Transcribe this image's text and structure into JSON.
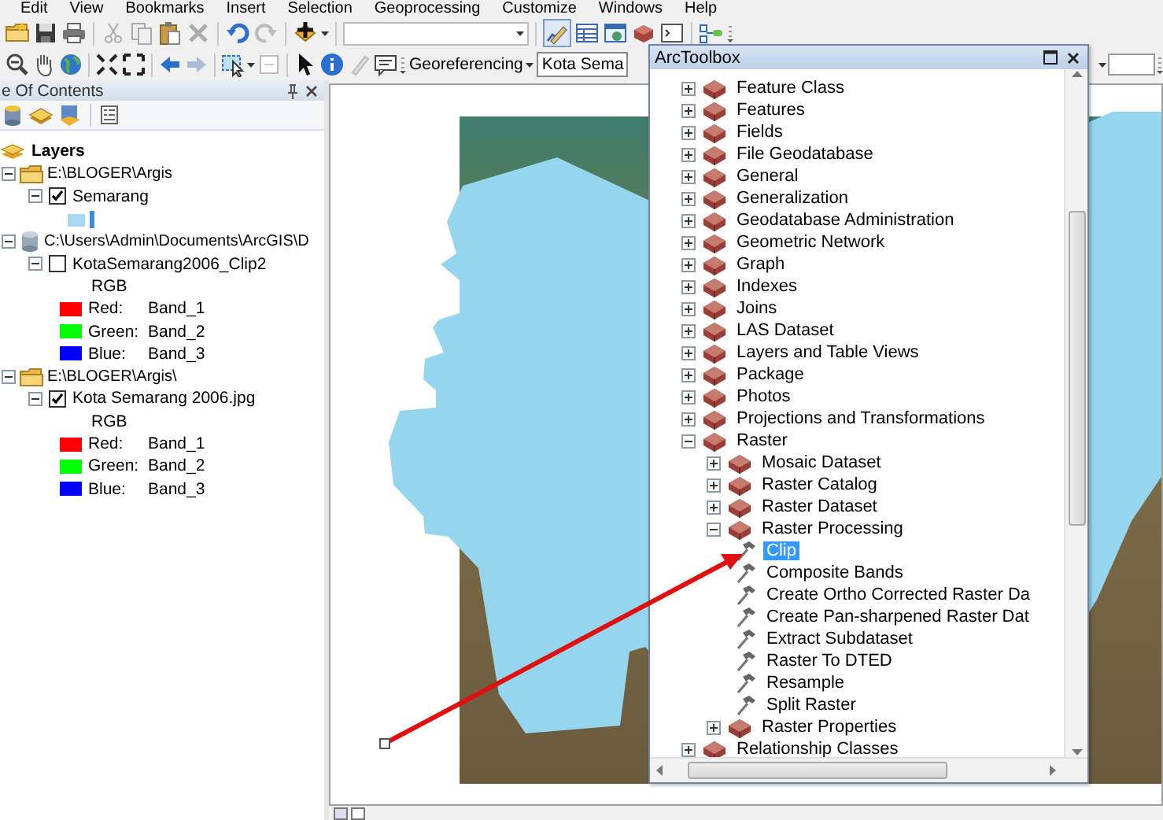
{
  "menu_bar": [
    "Edit",
    "View",
    "Bookmarks",
    "Insert",
    "Selection",
    "Geoprocessing",
    "Customize",
    "Windows",
    "Help"
  ],
  "toolbar": {
    "georeferencing": "Georeferencing",
    "layer_combo": "Kota Sema"
  },
  "table_of_contents": {
    "title": "e Of Contents",
    "root": "Layers",
    "groups": [
      {
        "kind": "folder",
        "path": "E:\\BLOGER\\Argis",
        "expanded": true,
        "layers": [
          {
            "kind": "polygon",
            "name": "Semarang",
            "checked": true,
            "expanded": true
          }
        ]
      },
      {
        "kind": "database",
        "path": "C:\\Users\\Admin\\Documents\\ArcGIS\\D",
        "expanded": true,
        "layers": [
          {
            "kind": "raster",
            "name": "KotaSemarang2006_Clip2",
            "checked": false,
            "expanded": true,
            "legend_title": "RGB",
            "bands": [
              {
                "label": "Red:",
                "band": "Band_1",
                "color": "#ff0000"
              },
              {
                "label": "Green:",
                "band": "Band_2",
                "color": "#00ff00"
              },
              {
                "label": "Blue:",
                "band": "Band_3",
                "color": "#0000ff"
              }
            ]
          }
        ]
      },
      {
        "kind": "folder",
        "path": "E:\\BLOGER\\Argis\\",
        "expanded": true,
        "layers": [
          {
            "kind": "raster",
            "name": "Kota Semarang 2006.jpg",
            "checked": true,
            "expanded": true,
            "legend_title": "RGB",
            "bands": [
              {
                "label": "Red:",
                "band": "Band_1",
                "color": "#ff0000"
              },
              {
                "label": "Green:",
                "band": "Band_2",
                "color": "#00ff00"
              },
              {
                "label": "Blue:",
                "band": "Band_3",
                "color": "#0000ff"
              }
            ]
          }
        ]
      }
    ]
  },
  "toolbox": {
    "title": "ArcToolbox",
    "items": [
      {
        "kind": "toolset",
        "label": "Feature Class",
        "expanded": false,
        "selected": false
      },
      {
        "kind": "toolset",
        "label": "Features",
        "expanded": false,
        "selected": false
      },
      {
        "kind": "toolset",
        "label": "Fields",
        "expanded": false,
        "selected": false
      },
      {
        "kind": "toolset",
        "label": "File Geodatabase",
        "expanded": false,
        "selected": false
      },
      {
        "kind": "toolset",
        "label": "General",
        "expanded": false,
        "selected": false
      },
      {
        "kind": "toolset",
        "label": "Generalization",
        "expanded": false,
        "selected": false
      },
      {
        "kind": "toolset",
        "label": "Geodatabase Administration",
        "expanded": false,
        "selected": false
      },
      {
        "kind": "toolset",
        "label": "Geometric Network",
        "expanded": false,
        "selected": false
      },
      {
        "kind": "toolset",
        "label": "Graph",
        "expanded": false,
        "selected": false
      },
      {
        "kind": "toolset",
        "label": "Indexes",
        "expanded": false,
        "selected": false
      },
      {
        "kind": "toolset",
        "label": "Joins",
        "expanded": false,
        "selected": false
      },
      {
        "kind": "toolset",
        "label": "LAS Dataset",
        "expanded": false,
        "selected": false
      },
      {
        "kind": "toolset",
        "label": "Layers and Table Views",
        "expanded": false,
        "selected": false
      },
      {
        "kind": "toolset",
        "label": "Package",
        "expanded": false,
        "selected": false
      },
      {
        "kind": "toolset",
        "label": "Photos",
        "expanded": false,
        "selected": false
      },
      {
        "kind": "toolset",
        "label": "Projections and Transformations",
        "expanded": false,
        "selected": false
      },
      {
        "kind": "toolset",
        "label": "Raster",
        "expanded": true,
        "selected": false,
        "children": [
          {
            "kind": "toolset",
            "label": "Mosaic Dataset",
            "expanded": false,
            "selected": false
          },
          {
            "kind": "toolset",
            "label": "Raster Catalog",
            "expanded": false,
            "selected": false
          },
          {
            "kind": "toolset",
            "label": "Raster Dataset",
            "expanded": false,
            "selected": false
          },
          {
            "kind": "toolset",
            "label": "Raster Processing",
            "expanded": true,
            "selected": false,
            "children": [
              {
                "kind": "tool",
                "label": "Clip",
                "selected": true
              },
              {
                "kind": "tool",
                "label": "Composite Bands",
                "selected": false
              },
              {
                "kind": "tool",
                "label": "Create Ortho Corrected Raster Da",
                "selected": false
              },
              {
                "kind": "tool",
                "label": "Create Pan-sharpened Raster Dat",
                "selected": false
              },
              {
                "kind": "tool",
                "label": "Extract Subdataset",
                "selected": false
              },
              {
                "kind": "tool",
                "label": "Raster To DTED",
                "selected": false
              },
              {
                "kind": "tool",
                "label": "Resample",
                "selected": false
              },
              {
                "kind": "tool",
                "label": "Split Raster",
                "selected": false
              }
            ]
          },
          {
            "kind": "toolset",
            "label": "Raster Properties",
            "expanded": false,
            "selected": false
          }
        ]
      },
      {
        "kind": "toolset",
        "label": "Relationship Classes",
        "expanded": false,
        "selected": false
      }
    ]
  }
}
